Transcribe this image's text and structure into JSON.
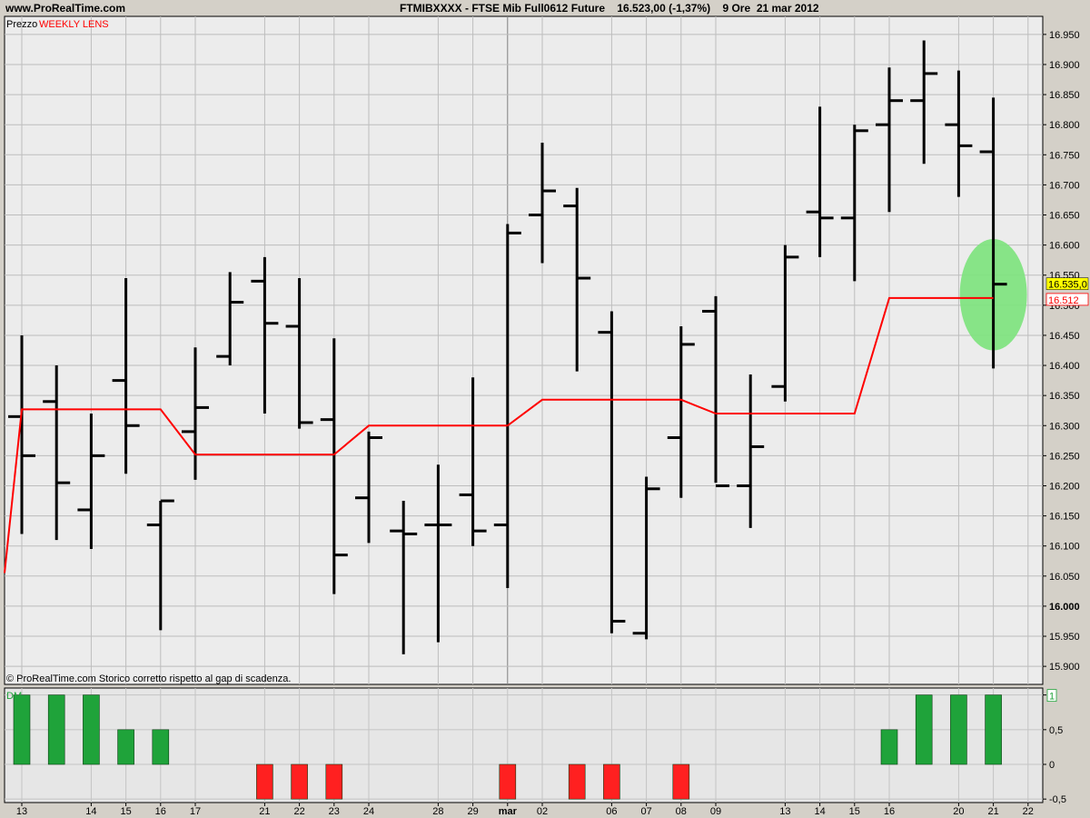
{
  "header": {
    "site": "www.ProRealTime.com",
    "instrument": "FTMIBXXXX - FTSE Mib Full0612 Future",
    "price_change": "16.523,00 (-1,37%)",
    "timeframe": "9 Ore",
    "date": "21 mar 2012"
  },
  "price_panel": {
    "label_prefix": "Prezzo",
    "label_indicator": "WEEKLY LENS",
    "footnote": "© ProRealTime.com  Storico corretto rispetto al gap di scadenza.",
    "marker_price_label": "16.535,0",
    "marker_lens_label": "16.512",
    "highlight_color": "#7ce37c"
  },
  "indicator_panel": {
    "label": "DM",
    "last_value_label": "1"
  },
  "colors": {
    "bars": "#000000",
    "lens": "#ff0000",
    "positive": "#1fa33a",
    "negative": "#ff2020",
    "price_marker_bg": "#ffff00"
  },
  "chart_data": [
    {
      "type": "ohlc",
      "title": "FTMIBXXXX - FTSE Mib Full0612 Future",
      "ylim": [
        15870,
        16980
      ],
      "yticks": [
        15900,
        15950,
        16000,
        16050,
        16100,
        16150,
        16200,
        16250,
        16300,
        16350,
        16400,
        16450,
        16500,
        16550,
        16600,
        16650,
        16700,
        16750,
        16800,
        16850,
        16900,
        16950
      ],
      "ytick_labels": [
        "15.900",
        "15.950",
        "16.000",
        "16.050",
        "16.100",
        "16.150",
        "16.200",
        "16.250",
        "16.300",
        "16.350",
        "16.400",
        "16.450",
        "16.500",
        "16.550",
        "16.600",
        "16.650",
        "16.700",
        "16.750",
        "16.800",
        "16.850",
        "16.900",
        "16.950"
      ],
      "x_labels": [
        {
          "i": 0,
          "label": "13"
        },
        {
          "i": 2,
          "label": "14"
        },
        {
          "i": 3,
          "label": "15"
        },
        {
          "i": 4,
          "label": "16"
        },
        {
          "i": 5,
          "label": "17"
        },
        {
          "i": 7,
          "label": "21"
        },
        {
          "i": 8,
          "label": "22"
        },
        {
          "i": 9,
          "label": "23"
        },
        {
          "i": 10,
          "label": "24"
        },
        {
          "i": 12,
          "label": "28"
        },
        {
          "i": 13,
          "label": "29"
        },
        {
          "i": 14,
          "label": "mar"
        },
        {
          "i": 15,
          "label": "02"
        },
        {
          "i": 17,
          "label": "06"
        },
        {
          "i": 18,
          "label": "07"
        },
        {
          "i": 19,
          "label": "08"
        },
        {
          "i": 20,
          "label": "09"
        },
        {
          "i": 22,
          "label": "13"
        },
        {
          "i": 23,
          "label": "14"
        },
        {
          "i": 24,
          "label": "15"
        },
        {
          "i": 25,
          "label": "16"
        },
        {
          "i": 27,
          "label": "20"
        },
        {
          "i": 28,
          "label": "21"
        },
        {
          "i": 29,
          "label": "22"
        }
      ],
      "bars": [
        {
          "o": 16315,
          "h": 16450,
          "l": 16120,
          "c": 16250
        },
        {
          "o": 16340,
          "h": 16400,
          "l": 16110,
          "c": 16205
        },
        {
          "o": 16160,
          "h": 16320,
          "l": 16095,
          "c": 16250
        },
        {
          "o": 16375,
          "h": 16545,
          "l": 16220,
          "c": 16300
        },
        {
          "o": 16135,
          "h": 16175,
          "l": 15960,
          "c": 16175
        },
        {
          "o": 16290,
          "h": 16430,
          "l": 16210,
          "c": 16330
        },
        {
          "o": 16415,
          "h": 16555,
          "l": 16400,
          "c": 16505
        },
        {
          "o": 16540,
          "h": 16580,
          "l": 16320,
          "c": 16470
        },
        {
          "o": 16465,
          "h": 16545,
          "l": 16295,
          "c": 16305
        },
        {
          "o": 16310,
          "h": 16445,
          "l": 16020,
          "c": 16085
        },
        {
          "o": 16180,
          "h": 16290,
          "l": 16105,
          "c": 16280
        },
        {
          "o": 16125,
          "h": 16175,
          "l": 15920,
          "c": 16120
        },
        {
          "o": 16135,
          "h": 16235,
          "l": 15940,
          "c": 16135
        },
        {
          "o": 16185,
          "h": 16380,
          "l": 16100,
          "c": 16125
        },
        {
          "o": 16135,
          "h": 16635,
          "l": 16030,
          "c": 16620
        },
        {
          "o": 16650,
          "h": 16770,
          "l": 16570,
          "c": 16690
        },
        {
          "o": 16665,
          "h": 16695,
          "l": 16390,
          "c": 16545
        },
        {
          "o": 16455,
          "h": 16490,
          "l": 15955,
          "c": 15975
        },
        {
          "o": 15955,
          "h": 16215,
          "l": 15945,
          "c": 16195
        },
        {
          "o": 16280,
          "h": 16465,
          "l": 16180,
          "c": 16435
        },
        {
          "o": 16490,
          "h": 16515,
          "l": 16205,
          "c": 16200
        },
        {
          "o": 16200,
          "h": 16385,
          "l": 16130,
          "c": 16265
        },
        {
          "o": 16365,
          "h": 16600,
          "l": 16340,
          "c": 16580
        },
        {
          "o": 16655,
          "h": 16830,
          "l": 16580,
          "c": 16645
        },
        {
          "o": 16645,
          "h": 16800,
          "l": 16540,
          "c": 16790
        },
        {
          "o": 16800,
          "h": 16895,
          "l": 16655,
          "c": 16840
        },
        {
          "o": 16840,
          "h": 16940,
          "l": 16735,
          "c": 16885
        },
        {
          "o": 16800,
          "h": 16890,
          "l": 16680,
          "c": 16765
        },
        {
          "o": 16755,
          "h": 16845,
          "l": 16395,
          "c": 16535
        }
      ],
      "series": [
        {
          "name": "WEEKLY LENS",
          "values": [
            16327,
            16327,
            16327,
            16327,
            16327,
            16252,
            16252,
            16252,
            16252,
            16252,
            16300,
            16300,
            16300,
            16300,
            16300,
            16343,
            16343,
            16343,
            16343,
            16343,
            16320,
            16320,
            16320,
            16320,
            16320,
            16512,
            16512,
            16512,
            16512
          ]
        }
      ],
      "lens_start_value": 16055,
      "highlight_index": 28,
      "highlight_range": [
        16425,
        16610
      ]
    },
    {
      "type": "bar",
      "title": "DM",
      "ylim": [
        -0.55,
        1.1
      ],
      "yticks": [
        -0.5,
        0,
        0.5,
        1
      ],
      "ytick_labels": [
        "-0,5",
        "0",
        "0,5",
        "1"
      ],
      "values": [
        1,
        1,
        1,
        0.5,
        0.5,
        0,
        0,
        -0.5,
        -0.5,
        -0.5,
        0,
        0,
        0,
        0,
        -0.5,
        0,
        -0.5,
        -0.5,
        0,
        -0.5,
        0,
        0,
        0,
        0,
        0,
        0.5,
        1,
        1,
        1
      ]
    }
  ]
}
